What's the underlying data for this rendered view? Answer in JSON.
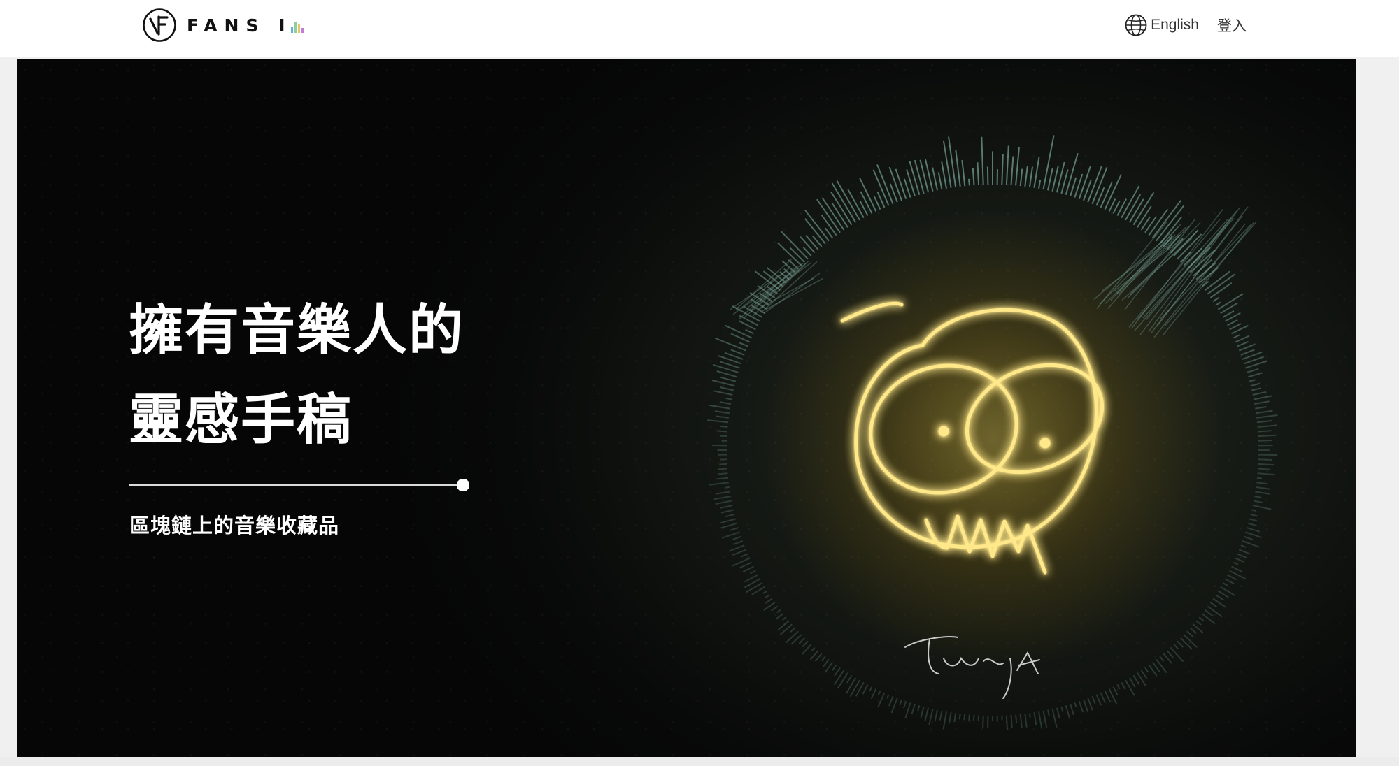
{
  "header": {
    "logo_text": "FANS I",
    "logo_bar_colors": [
      "#5fb3d6",
      "#8fcf9b",
      "#e7c56a",
      "#c27bd6"
    ],
    "language_label": "English",
    "login_label": "登入",
    "icons": {
      "language": "globe-icon"
    }
  },
  "hero": {
    "headline_line1": "擁有音樂人的",
    "headline_line2": "靈感手稿",
    "subheading": "區塊鏈上的音樂收藏品",
    "accent_color": "#ffd84a",
    "waveform_color": "#7aa79c"
  }
}
